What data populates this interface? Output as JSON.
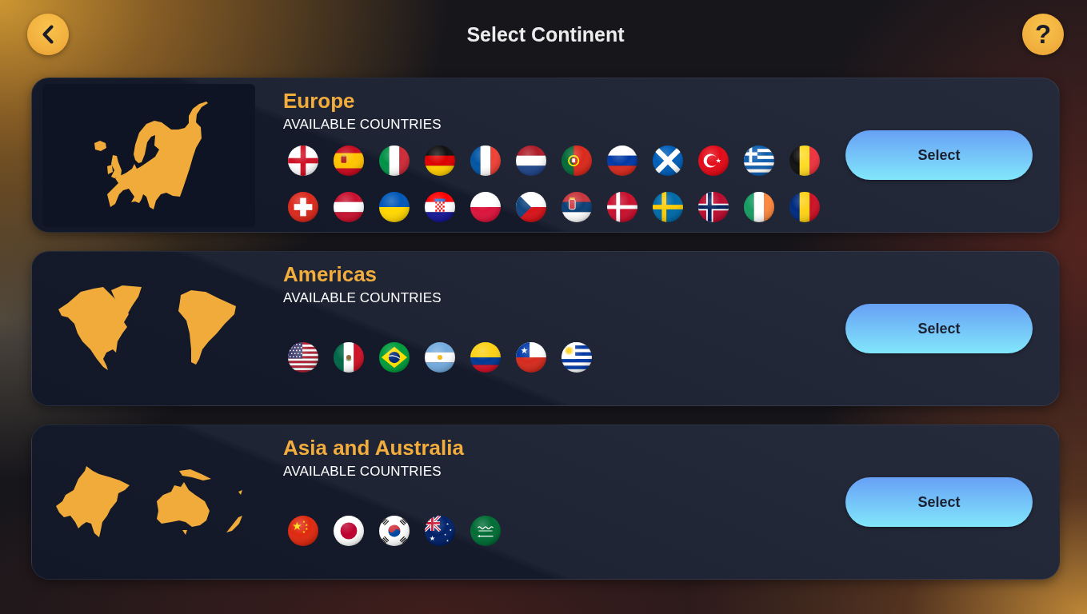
{
  "header": {
    "title": "Select Continent",
    "help_label": "?"
  },
  "continents": [
    {
      "kind": "europe",
      "name": "Europe",
      "subtitle": "AVAILABLE COUNTRIES",
      "flags": [
        {
          "kind": "england"
        },
        {
          "kind": "spain"
        },
        {
          "kind": "italy"
        },
        {
          "kind": "germany"
        },
        {
          "kind": "france"
        },
        {
          "kind": "netherlands"
        },
        {
          "kind": "portugal"
        },
        {
          "kind": "russia"
        },
        {
          "kind": "scotland"
        },
        {
          "kind": "turkey"
        },
        {
          "kind": "greece"
        },
        {
          "kind": "belgium"
        },
        {
          "kind": "switzerland"
        },
        {
          "kind": "austria"
        },
        {
          "kind": "ukraine"
        },
        {
          "kind": "croatia"
        },
        {
          "kind": "poland"
        },
        {
          "kind": "czechia"
        },
        {
          "kind": "serbia"
        },
        {
          "kind": "denmark"
        },
        {
          "kind": "sweden"
        },
        {
          "kind": "norway"
        },
        {
          "kind": "ireland"
        },
        {
          "kind": "romania"
        }
      ],
      "button": "Select"
    },
    {
      "kind": "americas",
      "name": "Americas",
      "subtitle": "AVAILABLE COUNTRIES",
      "flags": [
        {
          "kind": "usa"
        },
        {
          "kind": "mexico"
        },
        {
          "kind": "brazil"
        },
        {
          "kind": "argentina"
        },
        {
          "kind": "colombia"
        },
        {
          "kind": "chile"
        },
        {
          "kind": "uruguay"
        }
      ],
      "button": "Select"
    },
    {
      "kind": "asia",
      "name": "Asia and Australia",
      "subtitle": "AVAILABLE COUNTRIES",
      "flags": [
        {
          "kind": "china"
        },
        {
          "kind": "japan"
        },
        {
          "kind": "southkorea"
        },
        {
          "kind": "australia"
        },
        {
          "kind": "saudi"
        }
      ],
      "button": "Select"
    }
  ]
}
